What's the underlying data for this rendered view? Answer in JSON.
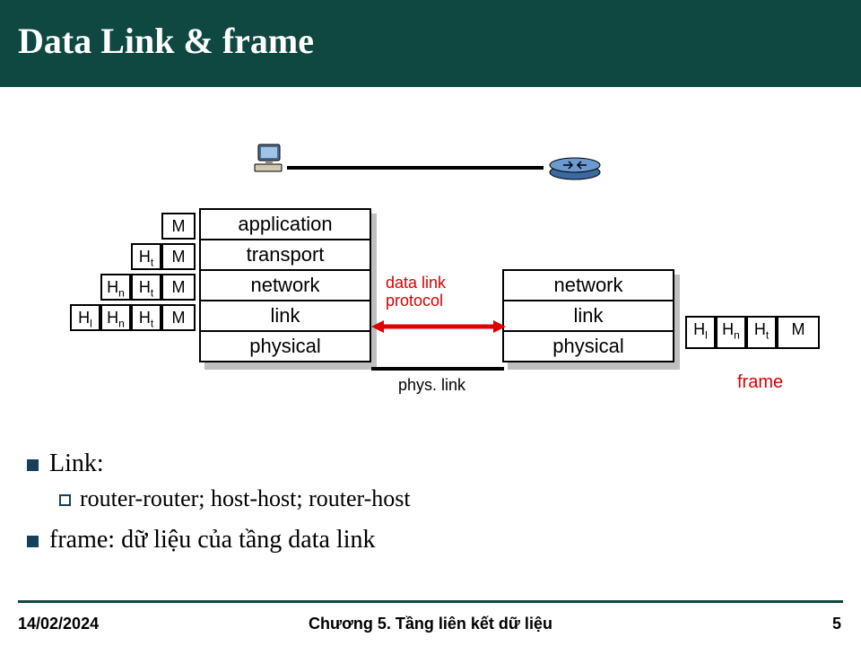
{
  "title": "Data Link & frame",
  "left_stack": [
    "application",
    "transport",
    "network",
    "link",
    "physical"
  ],
  "right_stack": [
    "network",
    "link",
    "physical"
  ],
  "left_headers": {
    "row1": [
      "M"
    ],
    "row2": [
      "H<sub>t</sub>",
      "M"
    ],
    "row3": [
      "H<sub>n</sub>",
      "H<sub>t</sub>",
      "M"
    ],
    "row4": [
      "H<sub>l</sub>",
      "H<sub>n</sub>",
      "H<sub>t</sub>",
      "M"
    ]
  },
  "right_headers": [
    "H<sub>l</sub>",
    "H<sub>n</sub>",
    "H<sub>t</sub>",
    "M"
  ],
  "dlp_label_1": "data link",
  "dlp_label_2": "protocol",
  "phys_label": "phys. link",
  "frame_label": "frame",
  "bullets": {
    "b1": "Link:",
    "b1_sub": "router-router; host-host; router-host",
    "b2": "frame: dữ liệu của tầng data link"
  },
  "footer": {
    "date": "14/02/2024",
    "chapter": "Chương 5. Tầng liên kết dữ liệu",
    "page": "5"
  }
}
